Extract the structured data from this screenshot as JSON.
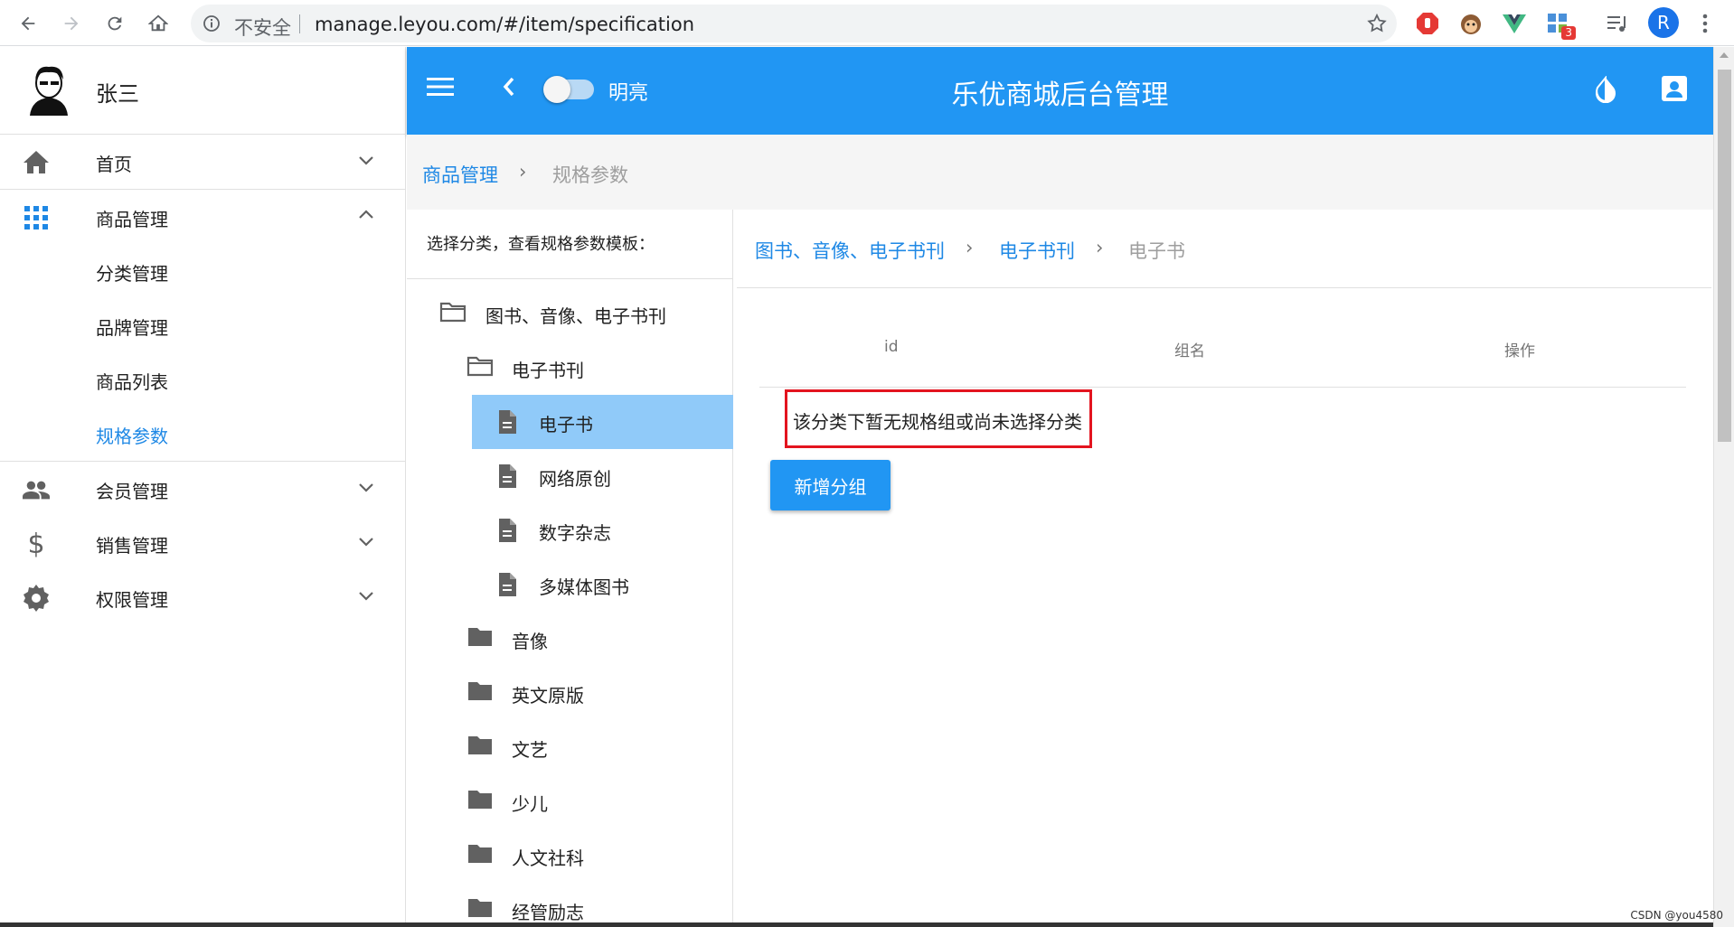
{
  "browser": {
    "security_label": "不安全",
    "url": "manage.leyou.com/#/item/specification",
    "extension_badge": "3",
    "profile_initial": "R"
  },
  "sidebar": {
    "user_name": "张三",
    "groups": [
      {
        "label": "首页",
        "icon": "home-icon",
        "expanded": false
      },
      {
        "label": "商品管理",
        "icon": "apps-icon",
        "expanded": true,
        "children": [
          {
            "label": "分类管理",
            "active": false
          },
          {
            "label": "品牌管理",
            "active": false
          },
          {
            "label": "商品列表",
            "active": false
          },
          {
            "label": "规格参数",
            "active": true
          }
        ]
      },
      {
        "label": "会员管理",
        "icon": "people-icon",
        "expanded": false
      },
      {
        "label": "销售管理",
        "icon": "dollar-icon",
        "expanded": false
      },
      {
        "label": "权限管理",
        "icon": "gear-icon",
        "expanded": false
      }
    ]
  },
  "appbar": {
    "theme_label": "明亮",
    "title": "乐优商城后台管理"
  },
  "breadcrumb": {
    "parent": "商品管理",
    "separator": "›",
    "current": "规格参数"
  },
  "tree": {
    "hint": "选择分类，查看规格参数模板：",
    "nodes": [
      {
        "label": "图书、音像、电子书刊",
        "type": "folder-open",
        "level": 0
      },
      {
        "label": "电子书刊",
        "type": "folder-open",
        "level": 1
      },
      {
        "label": "电子书",
        "type": "file",
        "level": 2,
        "selected": true
      },
      {
        "label": "网络原创",
        "type": "file",
        "level": 2
      },
      {
        "label": "数字杂志",
        "type": "file",
        "level": 2
      },
      {
        "label": "多媒体图书",
        "type": "file",
        "level": 2
      },
      {
        "label": "音像",
        "type": "folder",
        "level": 1
      },
      {
        "label": "英文原版",
        "type": "folder",
        "level": 1
      },
      {
        "label": "文艺",
        "type": "folder",
        "level": 1
      },
      {
        "label": "少儿",
        "type": "folder",
        "level": 1
      },
      {
        "label": "人文社科",
        "type": "folder",
        "level": 1
      },
      {
        "label": "经管励志",
        "type": "folder",
        "level": 1
      }
    ]
  },
  "spec": {
    "crumbs": [
      "图书、音像、电子书刊",
      "电子书刊",
      "电子书"
    ],
    "separator": "›",
    "columns": [
      "id",
      "组名",
      "操作"
    ],
    "empty_message": "该分类下暂无规格组或尚未选择分类",
    "add_button": "新增分组"
  },
  "watermark": "CSDN @you4580",
  "colors": {
    "primary": "#2196f3",
    "selected": "#90caf9",
    "highlight_border": "#e3141f"
  }
}
